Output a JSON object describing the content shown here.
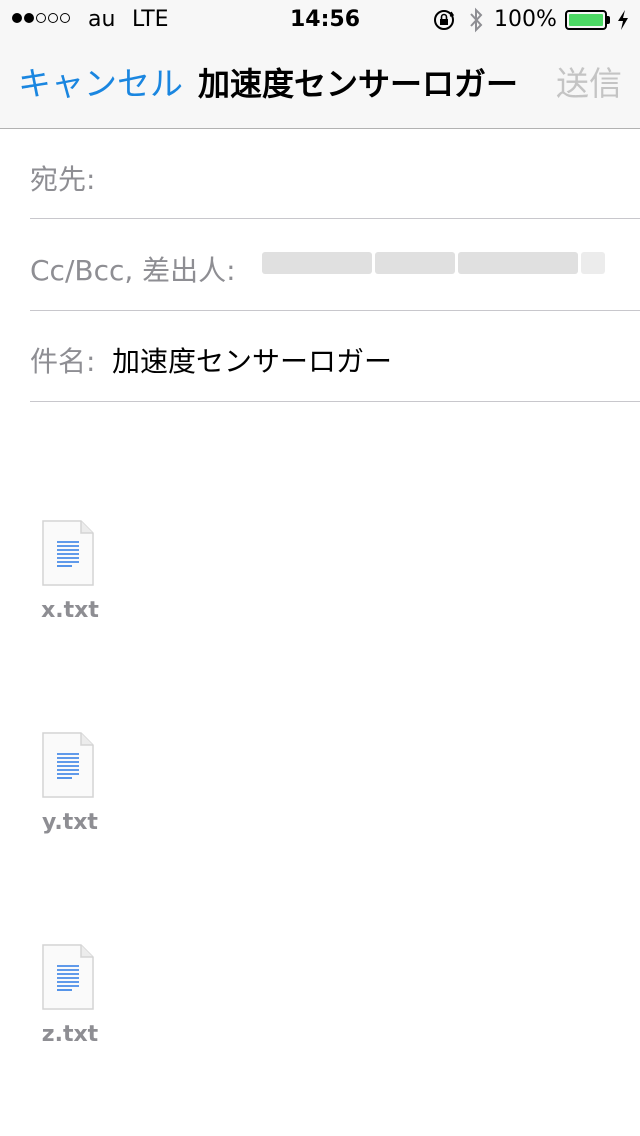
{
  "status_bar": {
    "signal": "●●○○○",
    "carrier": "au",
    "network": "LTE",
    "time": "14:56",
    "battery_percent": "100%",
    "battery_level": 1.0,
    "battery_color": "#4cd964"
  },
  "nav_bar": {
    "cancel_label": "キャンセル",
    "title": "加速度センサーロガー",
    "send_label": "送信",
    "accent_color": "#1a86e0",
    "disabled_color": "#c4c4c4"
  },
  "fields": {
    "to_label": "宛先:",
    "to_value": "",
    "ccbcc_label": "Cc/Bcc, 差出人:",
    "subject_label": "件名:",
    "subject_value": "加速度センサーロガー"
  },
  "attachments": [
    {
      "name": "x.txt",
      "icon": "text-document-icon"
    },
    {
      "name": "y.txt",
      "icon": "text-document-icon"
    },
    {
      "name": "z.txt",
      "icon": "text-document-icon"
    }
  ]
}
